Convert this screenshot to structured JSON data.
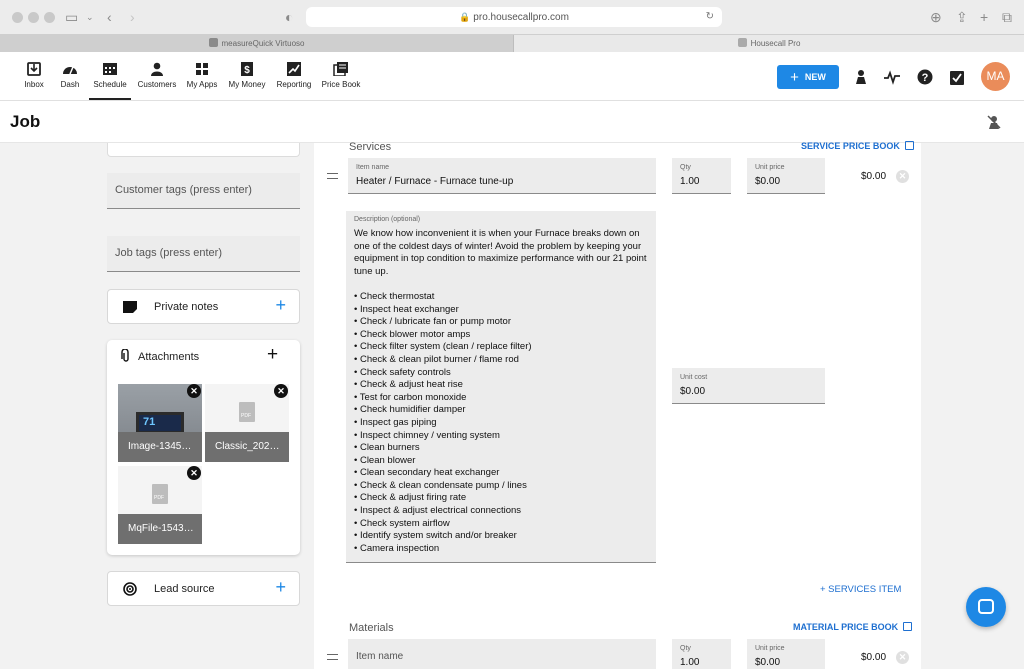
{
  "browser": {
    "url": "pro.housecallpro.com",
    "tabs": [
      {
        "label": "measureQuick Virtuoso",
        "active": false
      },
      {
        "label": "Housecall Pro",
        "active": true
      }
    ]
  },
  "nav": {
    "items": [
      {
        "label": "Inbox",
        "icon": "inbox-icon"
      },
      {
        "label": "Dash",
        "icon": "dashboard-icon"
      },
      {
        "label": "Schedule",
        "icon": "calendar-icon",
        "active": true
      },
      {
        "label": "Customers",
        "icon": "person-icon"
      },
      {
        "label": "My Apps",
        "icon": "apps-grid-icon"
      },
      {
        "label": "My Money",
        "icon": "dollar-icon"
      },
      {
        "label": "Reporting",
        "icon": "chart-icon"
      },
      {
        "label": "Price Book",
        "icon": "book-icon"
      }
    ],
    "new_button": "NEW",
    "avatar_initials": "MA",
    "accent": "#1e88e5"
  },
  "page": {
    "title": "Job"
  },
  "left": {
    "customer_tags_placeholder": "Customer tags (press enter)",
    "job_tags_placeholder": "Job tags (press enter)",
    "private_notes_label": "Private notes",
    "attachments_label": "Attachments",
    "attachments": [
      {
        "name": "Image-1345…",
        "type": "image",
        "thumb_text": "71"
      },
      {
        "name": "Classic_202…",
        "type": "pdf",
        "thumb_text": "PDF"
      },
      {
        "name": "MqFile-1543…",
        "type": "pdf",
        "thumb_text": "PDF"
      }
    ],
    "lead_source_label": "Lead source"
  },
  "services": {
    "title": "Services",
    "price_book_link": "SERVICE PRICE BOOK",
    "item": {
      "name_label": "Item name",
      "name_value": "Heater / Furnace - Furnace tune-up",
      "qty_label": "Qty",
      "qty_value": "1.00",
      "unit_price_label": "Unit price",
      "unit_price_value": "$0.00",
      "amount": "$0.00",
      "unit_cost_label": "Unit cost",
      "unit_cost_value": "$0.00",
      "description_label": "Description (optional)",
      "description": "We know how inconvenient it is when your Furnace breaks down on one of the coldest days of winter! Avoid the problem by keeping your equipment in top condition to maximize performance with our 21 point tune up.\n\n• Check thermostat\n• Inspect heat exchanger\n• Check / lubricate fan or pump motor\n• Check blower motor amps\n• Check filter system (clean / replace filter)\n• Check & clean pilot burner / flame rod\n• Check safety controls\n• Check & adjust heat rise\n• Test for carbon monoxide\n• Check humidifier damper\n• Inspect gas piping\n• Inspect chimney / venting system\n• Clean burners\n• Clean blower\n• Clean secondary heat exchanger\n• Check & clean condensate pump / lines\n• Check & adjust firing rate\n• Inspect & adjust electrical connections\n• Check system airflow\n• Identify system switch and/or breaker\n• Camera inspection"
    },
    "add_item": "+ SERVICES ITEM"
  },
  "materials": {
    "title": "Materials",
    "price_book_link": "MATERIAL PRICE BOOK",
    "item": {
      "name_placeholder": "Item name",
      "qty_label": "Qty",
      "qty_value": "1.00",
      "unit_price_label": "Unit price",
      "unit_price_value": "$0.00",
      "amount": "$0.00"
    }
  }
}
